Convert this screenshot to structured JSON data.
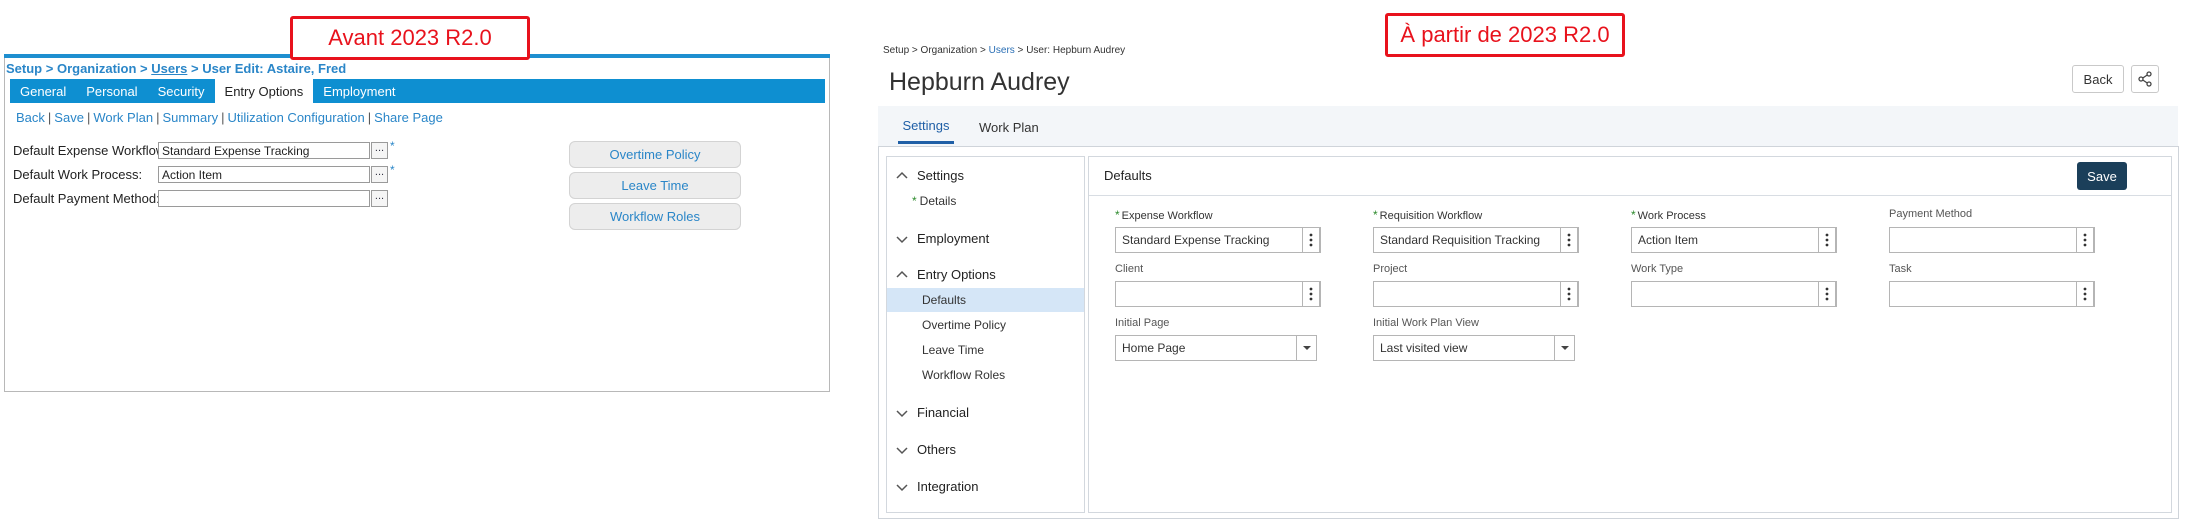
{
  "callouts": {
    "before": "Avant 2023 R2.0",
    "after": "À partir de 2023 R2.0"
  },
  "old_ui": {
    "breadcrumb": {
      "setup": "Setup",
      "sep": " > ",
      "organization": "Organization",
      "users": "Users",
      "current": "User Edit: Astaire, Fred"
    },
    "tabs": [
      "General",
      "Personal",
      "Security",
      "Entry Options",
      "Employment"
    ],
    "active_tab": "Entry Options",
    "links": [
      "Back",
      "Save",
      "Work Plan",
      "Summary",
      "Utilization Configuration",
      "Share Page"
    ],
    "link_sep": "|",
    "fields": [
      {
        "label": "Default Expense Workflow:",
        "value": "Standard Expense Tracking",
        "required": "*"
      },
      {
        "label": "Default Work Process:",
        "value": "Action Item",
        "required": "*"
      },
      {
        "label": "Default Payment Method:",
        "value": "",
        "required": ""
      }
    ],
    "dots_label": "...",
    "side_buttons": [
      "Overtime Policy",
      "Leave Time",
      "Workflow Roles"
    ]
  },
  "new_ui": {
    "breadcrumb": {
      "setup": "Setup",
      "organization": "Organization",
      "users": "Users",
      "current": "User: Hepburn Audrey",
      "sep": " > "
    },
    "title": "Hepburn Audrey",
    "back_label": "Back",
    "share_icon": "share-icon",
    "tabs": [
      "Settings",
      "Work Plan"
    ],
    "nav": {
      "sections": [
        {
          "label": "Settings",
          "expanded": true,
          "items": [
            "Details"
          ]
        },
        {
          "label": "Employment",
          "expanded": false,
          "items": []
        },
        {
          "label": "Entry Options",
          "expanded": true,
          "items": [
            "Defaults",
            "Overtime Policy",
            "Leave Time",
            "Workflow Roles"
          ]
        },
        {
          "label": "Financial",
          "expanded": false,
          "items": []
        },
        {
          "label": "Others",
          "expanded": false,
          "items": []
        },
        {
          "label": "Integration",
          "expanded": false,
          "items": []
        }
      ],
      "selected": "Defaults"
    },
    "content": {
      "title": "Defaults",
      "save_label": "Save",
      "required_mark": "*",
      "fields": [
        {
          "label": "Expense Workflow",
          "value": "Standard Expense Tracking",
          "required": true
        },
        {
          "label": "Requisition Workflow",
          "value": "Standard Requisition Tracking",
          "required": true
        },
        {
          "label": "Work Process",
          "value": "Action Item",
          "required": true
        },
        {
          "label": "Payment Method",
          "value": "",
          "required": false
        },
        {
          "label": "Client",
          "value": "",
          "required": false
        },
        {
          "label": "Project",
          "value": "",
          "required": false
        },
        {
          "label": "Work Type",
          "value": "",
          "required": false
        },
        {
          "label": "Task",
          "value": "",
          "required": false
        }
      ],
      "selects": [
        {
          "label": "Initial Page",
          "value": "Home Page"
        },
        {
          "label": "Initial Work Plan View",
          "value": "Last visited view"
        }
      ]
    },
    "colors": {
      "accent": "#1f5fa6",
      "save_bg": "#1b3f5a",
      "nav_selected": "#d5e6f7",
      "required": "#2e8b2e"
    }
  }
}
